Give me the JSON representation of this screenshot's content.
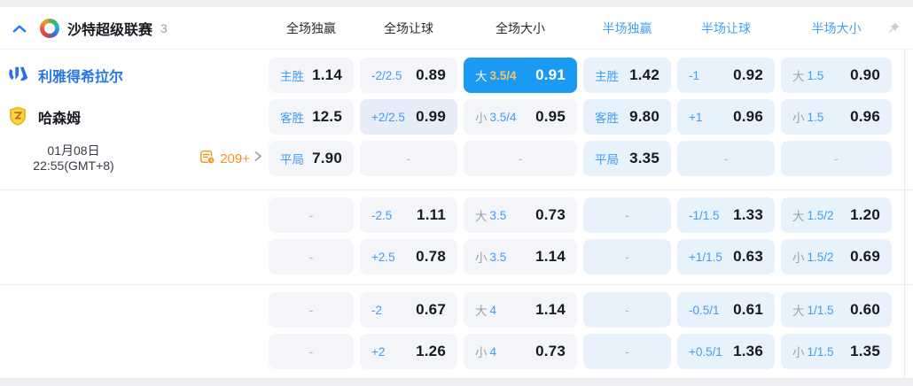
{
  "header": {
    "league": {
      "name": "沙特超级联赛",
      "count": "3"
    },
    "columns": [
      {
        "label": "全场独赢"
      },
      {
        "label": "全场让球"
      },
      {
        "label": "全场大小"
      },
      {
        "label": "半场独赢"
      },
      {
        "label": "半场让球"
      },
      {
        "label": "半场大小"
      }
    ]
  },
  "match": {
    "home_team": "利雅得希拉尔",
    "away_team": "哈森姆",
    "date": "01月08日",
    "time": "22:55(GMT+8)",
    "more_markets": "209+"
  },
  "colors": {
    "selected_cell_blue": "#1b9af3",
    "label_blue": "#3f9df2",
    "half_column_blue": "#42a1f5",
    "selected_handicap_gold": "#f7c468",
    "more_markets_orange": "#f7941e",
    "home_team_blue": "#2677e5"
  },
  "odds": {
    "rows": [
      {
        "cells": [
          {
            "label": "主胜",
            "value": "1.14"
          },
          {
            "label": "-2/2.5",
            "value": "0.89"
          },
          {
            "prefix": "大",
            "label": "3.5/4",
            "value": "0.91",
            "selected": true
          },
          {
            "label": "主胜",
            "value": "1.42"
          },
          {
            "label": "-1",
            "value": "0.92"
          },
          {
            "prefix": "大",
            "label": "1.5",
            "value": "0.90"
          }
        ]
      },
      {
        "cells": [
          {
            "label": "客胜",
            "value": "12.5"
          },
          {
            "label": "+2/2.5",
            "value": "0.99",
            "changed": true
          },
          {
            "prefix": "小",
            "label": "3.5/4",
            "value": "0.95"
          },
          {
            "label": "客胜",
            "value": "9.80"
          },
          {
            "label": "+1",
            "value": "0.96"
          },
          {
            "prefix": "小",
            "label": "1.5",
            "value": "0.96"
          }
        ]
      },
      {
        "cells": [
          {
            "label": "平局",
            "value": "7.90"
          },
          {
            "value": "-"
          },
          {
            "value": "-"
          },
          {
            "label": "平局",
            "value": "3.35"
          },
          {
            "value": "-"
          },
          {
            "value": "-"
          }
        ]
      },
      {
        "cells": [
          {
            "value": "-"
          },
          {
            "label": "-2.5",
            "value": "1.11"
          },
          {
            "prefix": "大",
            "label": "3.5",
            "value": "0.73"
          },
          {
            "value": "-"
          },
          {
            "label": "-1/1.5",
            "value": "1.33"
          },
          {
            "prefix": "大",
            "label": "1.5/2",
            "value": "1.20"
          }
        ]
      },
      {
        "cells": [
          {
            "value": "-"
          },
          {
            "label": "+2.5",
            "value": "0.78"
          },
          {
            "prefix": "小",
            "label": "3.5",
            "value": "1.14"
          },
          {
            "value": "-"
          },
          {
            "label": "+1/1.5",
            "value": "0.63"
          },
          {
            "prefix": "小",
            "label": "1.5/2",
            "value": "0.69"
          }
        ]
      },
      {
        "cells": [
          {
            "value": "-"
          },
          {
            "label": "-2",
            "value": "0.67"
          },
          {
            "prefix": "大",
            "label": "4",
            "value": "1.14"
          },
          {
            "value": "-"
          },
          {
            "label": "-0.5/1",
            "value": "0.61"
          },
          {
            "prefix": "大",
            "label": "1/1.5",
            "value": "0.60"
          }
        ]
      },
      {
        "cells": [
          {
            "value": "-"
          },
          {
            "label": "+2",
            "value": "1.26"
          },
          {
            "prefix": "小",
            "label": "4",
            "value": "0.73"
          },
          {
            "value": "-"
          },
          {
            "label": "+0.5/1",
            "value": "1.36"
          },
          {
            "prefix": "小",
            "label": "1/1.5",
            "value": "1.35"
          }
        ]
      }
    ]
  }
}
